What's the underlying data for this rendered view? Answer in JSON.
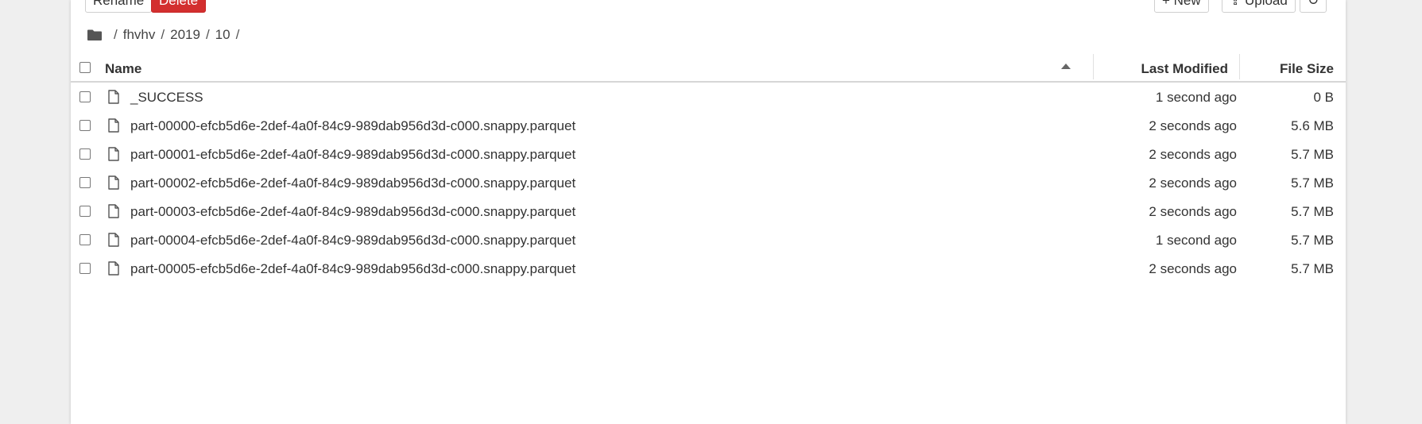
{
  "toolbar": {
    "rename_label": "Rename",
    "delete_label": "Delete",
    "new_label": "+ New",
    "upload_label": "⇪ Upload",
    "refresh_label": "↻"
  },
  "breadcrumb": {
    "separator": "/",
    "parts": [
      "fhvhv",
      "2019",
      "10"
    ]
  },
  "table": {
    "columns": {
      "name": "Name",
      "last_modified": "Last Modified",
      "file_size": "File Size"
    },
    "rows": [
      {
        "name": "_SUCCESS",
        "modified": "1 second ago",
        "size": "0 B"
      },
      {
        "name": "part-00000-efcb5d6e-2def-4a0f-84c9-989dab956d3d-c000.snappy.parquet",
        "modified": "2 seconds ago",
        "size": "5.6 MB"
      },
      {
        "name": "part-00001-efcb5d6e-2def-4a0f-84c9-989dab956d3d-c000.snappy.parquet",
        "modified": "2 seconds ago",
        "size": "5.7 MB"
      },
      {
        "name": "part-00002-efcb5d6e-2def-4a0f-84c9-989dab956d3d-c000.snappy.parquet",
        "modified": "2 seconds ago",
        "size": "5.7 MB"
      },
      {
        "name": "part-00003-efcb5d6e-2def-4a0f-84c9-989dab956d3d-c000.snappy.parquet",
        "modified": "2 seconds ago",
        "size": "5.7 MB"
      },
      {
        "name": "part-00004-efcb5d6e-2def-4a0f-84c9-989dab956d3d-c000.snappy.parquet",
        "modified": "1 second ago",
        "size": "5.7 MB"
      },
      {
        "name": "part-00005-efcb5d6e-2def-4a0f-84c9-989dab956d3d-c000.snappy.parquet",
        "modified": "2 seconds ago",
        "size": "5.7 MB"
      }
    ]
  },
  "colors": {
    "danger": "#d32f2f",
    "background": "#efefef",
    "panel": "#ffffff"
  },
  "icons": {
    "breadcrumb": "folder-icon",
    "file": "file-icon",
    "sort": "sort-ascending-icon"
  }
}
